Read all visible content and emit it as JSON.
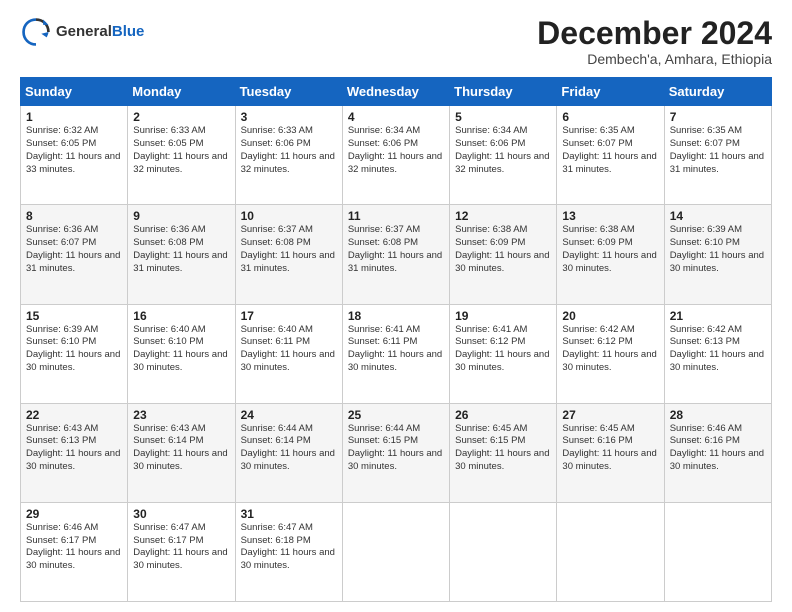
{
  "logo": {
    "general": "General",
    "blue": "Blue"
  },
  "header": {
    "month": "December 2024",
    "location": "Dembech'a, Amhara, Ethiopia"
  },
  "weekdays": [
    "Sunday",
    "Monday",
    "Tuesday",
    "Wednesday",
    "Thursday",
    "Friday",
    "Saturday"
  ],
  "weeks": [
    [
      {
        "day": "1",
        "sunrise": "6:32 AM",
        "sunset": "6:05 PM",
        "daylight": "11 hours and 33 minutes."
      },
      {
        "day": "2",
        "sunrise": "6:33 AM",
        "sunset": "6:05 PM",
        "daylight": "11 hours and 32 minutes."
      },
      {
        "day": "3",
        "sunrise": "6:33 AM",
        "sunset": "6:06 PM",
        "daylight": "11 hours and 32 minutes."
      },
      {
        "day": "4",
        "sunrise": "6:34 AM",
        "sunset": "6:06 PM",
        "daylight": "11 hours and 32 minutes."
      },
      {
        "day": "5",
        "sunrise": "6:34 AM",
        "sunset": "6:06 PM",
        "daylight": "11 hours and 32 minutes."
      },
      {
        "day": "6",
        "sunrise": "6:35 AM",
        "sunset": "6:07 PM",
        "daylight": "11 hours and 31 minutes."
      },
      {
        "day": "7",
        "sunrise": "6:35 AM",
        "sunset": "6:07 PM",
        "daylight": "11 hours and 31 minutes."
      }
    ],
    [
      {
        "day": "8",
        "sunrise": "6:36 AM",
        "sunset": "6:07 PM",
        "daylight": "11 hours and 31 minutes."
      },
      {
        "day": "9",
        "sunrise": "6:36 AM",
        "sunset": "6:08 PM",
        "daylight": "11 hours and 31 minutes."
      },
      {
        "day": "10",
        "sunrise": "6:37 AM",
        "sunset": "6:08 PM",
        "daylight": "11 hours and 31 minutes."
      },
      {
        "day": "11",
        "sunrise": "6:37 AM",
        "sunset": "6:08 PM",
        "daylight": "11 hours and 31 minutes."
      },
      {
        "day": "12",
        "sunrise": "6:38 AM",
        "sunset": "6:09 PM",
        "daylight": "11 hours and 30 minutes."
      },
      {
        "day": "13",
        "sunrise": "6:38 AM",
        "sunset": "6:09 PM",
        "daylight": "11 hours and 30 minutes."
      },
      {
        "day": "14",
        "sunrise": "6:39 AM",
        "sunset": "6:10 PM",
        "daylight": "11 hours and 30 minutes."
      }
    ],
    [
      {
        "day": "15",
        "sunrise": "6:39 AM",
        "sunset": "6:10 PM",
        "daylight": "11 hours and 30 minutes."
      },
      {
        "day": "16",
        "sunrise": "6:40 AM",
        "sunset": "6:10 PM",
        "daylight": "11 hours and 30 minutes."
      },
      {
        "day": "17",
        "sunrise": "6:40 AM",
        "sunset": "6:11 PM",
        "daylight": "11 hours and 30 minutes."
      },
      {
        "day": "18",
        "sunrise": "6:41 AM",
        "sunset": "6:11 PM",
        "daylight": "11 hours and 30 minutes."
      },
      {
        "day": "19",
        "sunrise": "6:41 AM",
        "sunset": "6:12 PM",
        "daylight": "11 hours and 30 minutes."
      },
      {
        "day": "20",
        "sunrise": "6:42 AM",
        "sunset": "6:12 PM",
        "daylight": "11 hours and 30 minutes."
      },
      {
        "day": "21",
        "sunrise": "6:42 AM",
        "sunset": "6:13 PM",
        "daylight": "11 hours and 30 minutes."
      }
    ],
    [
      {
        "day": "22",
        "sunrise": "6:43 AM",
        "sunset": "6:13 PM",
        "daylight": "11 hours and 30 minutes."
      },
      {
        "day": "23",
        "sunrise": "6:43 AM",
        "sunset": "6:14 PM",
        "daylight": "11 hours and 30 minutes."
      },
      {
        "day": "24",
        "sunrise": "6:44 AM",
        "sunset": "6:14 PM",
        "daylight": "11 hours and 30 minutes."
      },
      {
        "day": "25",
        "sunrise": "6:44 AM",
        "sunset": "6:15 PM",
        "daylight": "11 hours and 30 minutes."
      },
      {
        "day": "26",
        "sunrise": "6:45 AM",
        "sunset": "6:15 PM",
        "daylight": "11 hours and 30 minutes."
      },
      {
        "day": "27",
        "sunrise": "6:45 AM",
        "sunset": "6:16 PM",
        "daylight": "11 hours and 30 minutes."
      },
      {
        "day": "28",
        "sunrise": "6:46 AM",
        "sunset": "6:16 PM",
        "daylight": "11 hours and 30 minutes."
      }
    ],
    [
      {
        "day": "29",
        "sunrise": "6:46 AM",
        "sunset": "6:17 PM",
        "daylight": "11 hours and 30 minutes."
      },
      {
        "day": "30",
        "sunrise": "6:47 AM",
        "sunset": "6:17 PM",
        "daylight": "11 hours and 30 minutes."
      },
      {
        "day": "31",
        "sunrise": "6:47 AM",
        "sunset": "6:18 PM",
        "daylight": "11 hours and 30 minutes."
      },
      null,
      null,
      null,
      null
    ]
  ]
}
